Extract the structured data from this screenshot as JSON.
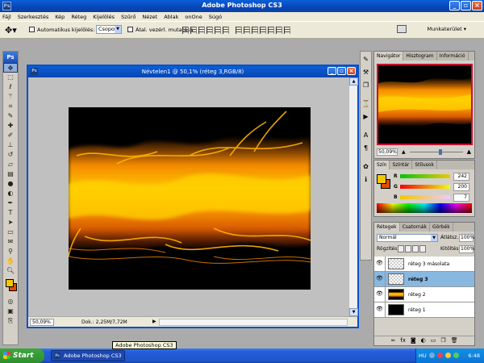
{
  "app": {
    "title": "Adobe Photoshop CS3",
    "logo": "Ps"
  },
  "menu": [
    "Fájl",
    "Szerkesztés",
    "Kép",
    "Réteg",
    "Kijelölés",
    "Szűrő",
    "Nézet",
    "Ablak",
    "onOne",
    "Súgó"
  ],
  "options": {
    "auto_select_label": "Automatikus kijelölés:",
    "group_select_value": "Csoport",
    "show_transform_label": "Átal. vezérl. mutatása",
    "workspace_label": "Munkaterület ▾"
  },
  "document": {
    "title": "Névtelen1 @ 50,1% (réteg 3,RGB/8)",
    "zoom": "50,09%",
    "doc_info": "Dok.: 2,25M/7,72M"
  },
  "tooltip": "Adobe Photoshop CS3",
  "navigator": {
    "tabs": [
      "Navigátor",
      "Hisztogram",
      "Információ"
    ],
    "zoom": "50,09%"
  },
  "color_panel": {
    "tabs": [
      "Szín",
      "Színtár",
      "Stílusok"
    ],
    "channels": [
      {
        "label": "R",
        "value": "242"
      },
      {
        "label": "G",
        "value": "200"
      },
      {
        "label": "B",
        "value": "7"
      }
    ],
    "fg_color": "#f2c800",
    "bg_color": "#e34b00"
  },
  "layers_panel": {
    "tabs": [
      "Rétegek",
      "Csatornák",
      "Görbék"
    ],
    "blend_mode": "Normál",
    "opacity_label": "Átlátsz.:",
    "opacity_value": "100%",
    "lock_label": "Rögzítés:",
    "fill_label": "Kitöltés:",
    "fill_value": "100%",
    "layers": [
      {
        "name": "réteg 3 másolata",
        "thumb": "checker",
        "selected": false
      },
      {
        "name": "réteg 3",
        "thumb": "checker",
        "selected": true
      },
      {
        "name": "réteg 2",
        "thumb": "fire",
        "selected": false
      },
      {
        "name": "réteg 1",
        "thumb": "black",
        "selected": false
      }
    ]
  },
  "taskbar": {
    "start_label": "Start",
    "task_item": "Adobe Photoshop CS3",
    "lang": "HU",
    "clock": "6:48"
  }
}
